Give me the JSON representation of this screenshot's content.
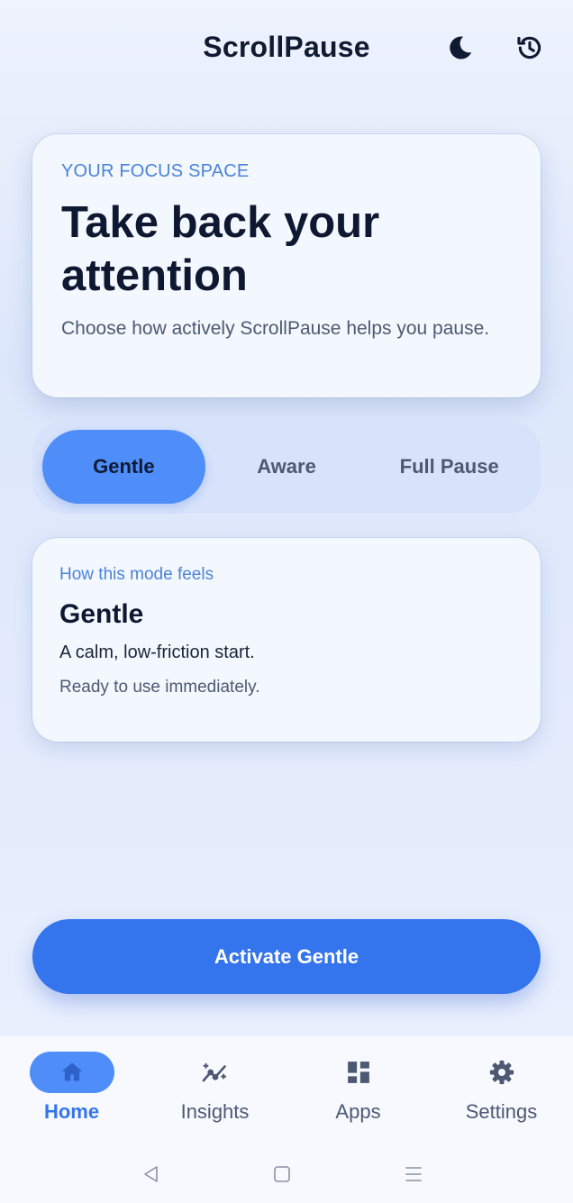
{
  "header": {
    "title": "ScrollPause",
    "icons": [
      "moon-icon",
      "history-icon"
    ]
  },
  "hero": {
    "eyebrow": "YOUR FOCUS SPACE",
    "title": "Take back your attention",
    "subtitle": "Choose how actively ScrollPause helps you pause."
  },
  "modes": {
    "options": [
      "Gentle",
      "Aware",
      "Full Pause"
    ],
    "selected": "Gentle"
  },
  "mode_card": {
    "eyebrow": "How this mode feels",
    "title": "Gentle",
    "description": "A calm, low-friction start.",
    "status": "Ready to use immediately."
  },
  "cta": {
    "label": "Activate Gentle"
  },
  "bottom_nav": {
    "items": [
      {
        "label": "Home",
        "icon": "home-icon",
        "active": true
      },
      {
        "label": "Insights",
        "icon": "insights-icon",
        "active": false
      },
      {
        "label": "Apps",
        "icon": "apps-icon",
        "active": false
      },
      {
        "label": "Settings",
        "icon": "gear-icon",
        "active": false
      }
    ]
  },
  "colors": {
    "accent": "#3474ed",
    "accent_light": "#4f8df9",
    "eyebrow": "#4b84d8",
    "text_dark": "#0e1830",
    "text_muted": "#4e5a71"
  }
}
